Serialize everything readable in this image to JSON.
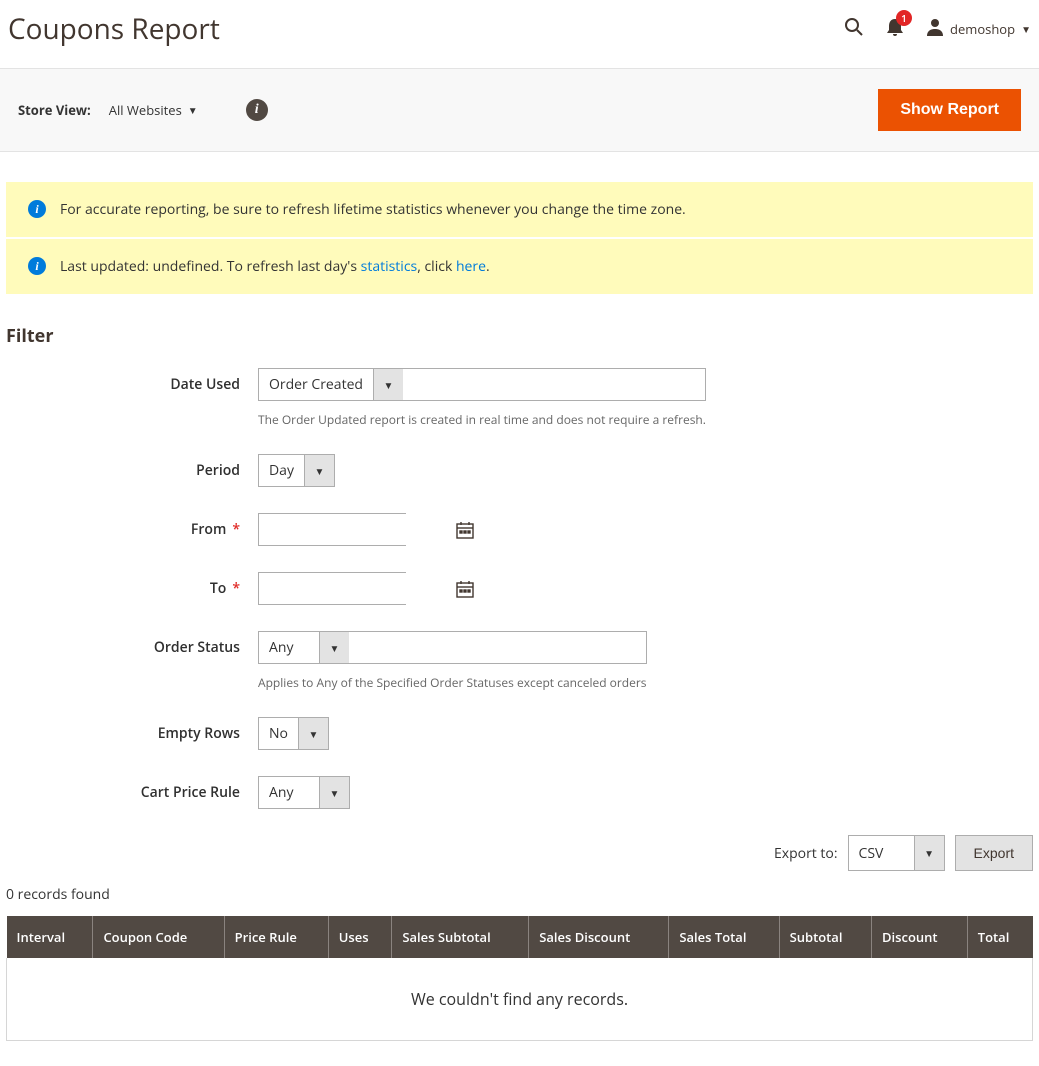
{
  "header": {
    "title": "Coupons Report",
    "notification_count": "1",
    "user_name": "demoshop"
  },
  "store_view": {
    "label": "Store View:",
    "value": "All Websites",
    "show_report_btn": "Show Report"
  },
  "messages": {
    "m1": "For accurate reporting, be sure to refresh lifetime statistics whenever you change the time zone.",
    "m2_prefix": "Last updated: undefined. To refresh last day's ",
    "m2_link1": "statistics",
    "m2_mid": ", click ",
    "m2_link2": "here",
    "m2_suffix": "."
  },
  "filter": {
    "title": "Filter",
    "date_used": {
      "label": "Date Used",
      "value": "Order Created",
      "hint": "The Order Updated report is created in real time and does not require a refresh."
    },
    "period": {
      "label": "Period",
      "value": "Day"
    },
    "from": {
      "label": "From",
      "value": ""
    },
    "to": {
      "label": "To",
      "value": ""
    },
    "order_status": {
      "label": "Order Status",
      "value": "Any",
      "hint": "Applies to Any of the Specified Order Statuses except canceled orders"
    },
    "empty_rows": {
      "label": "Empty Rows",
      "value": "No"
    },
    "cart_rule": {
      "label": "Cart Price Rule",
      "value": "Any"
    }
  },
  "export": {
    "label": "Export to:",
    "format": "CSV",
    "btn": "Export"
  },
  "grid": {
    "records_text": "0 records found",
    "columns": [
      "Interval",
      "Coupon Code",
      "Price Rule",
      "Uses",
      "Sales Subtotal",
      "Sales Discount",
      "Sales Total",
      "Subtotal",
      "Discount",
      "Total"
    ],
    "empty_msg": "We couldn't find any records."
  }
}
